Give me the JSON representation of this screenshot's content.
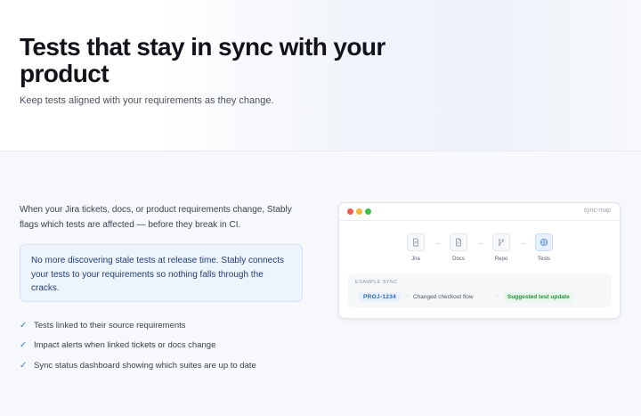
{
  "hero": {
    "title": "Tests that stay in sync with your product",
    "subtitle": "Keep tests aligned with your requirements as they change."
  },
  "intro": {
    "text": "When your Jira tickets, docs, or product requirements change, Stably flags which tests are affected — before they break in CI."
  },
  "callout": {
    "text": "No more discovering stale tests at release time. Stably connects your tests to your requirements so nothing falls through the cracks."
  },
  "features": [
    "Tests linked to their source requirements",
    "Impact alerts when linked tickets or docs change",
    "Sync status dashboard showing which suites are up to date"
  ],
  "sync_map": {
    "window_title": "sync-map",
    "nodes": [
      {
        "label": "Jira",
        "icon": "document-icon"
      },
      {
        "label": "Docs",
        "icon": "file-text-icon"
      },
      {
        "label": "Repo",
        "icon": "git-branch-icon"
      },
      {
        "label": "Tests",
        "icon": "target-icon",
        "active": true
      }
    ],
    "example": {
      "label": "EXAMPLE SYNC",
      "ticket_id": "PROJ-1234",
      "change": "Changed checkout flow",
      "result": "Suggested test update"
    }
  },
  "colors": {
    "accent_blue": "#3b7bd6",
    "success_green": "#23923c",
    "callout_bg": "#eef4fd"
  }
}
